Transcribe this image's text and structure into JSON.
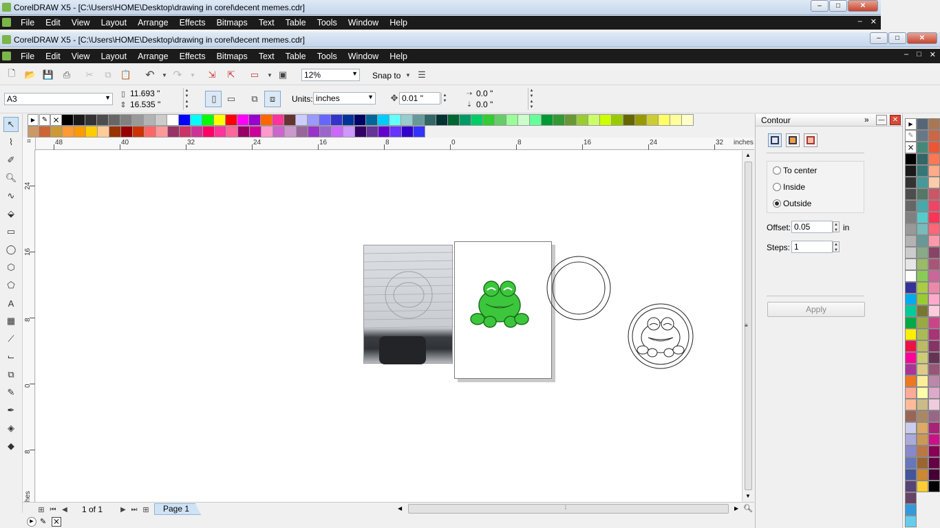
{
  "window_outer": {
    "title": "CorelDRAW X5 - [C:\\Users\\HOME\\Desktop\\drawing in corel\\decent memes.cdr]"
  },
  "window_inner": {
    "title": "CorelDRAW X5 - [C:\\Users\\HOME\\Desktop\\drawing in corel\\decent memes.cdr]"
  },
  "menu": {
    "items": [
      "File",
      "Edit",
      "View",
      "Layout",
      "Arrange",
      "Effects",
      "Bitmaps",
      "Text",
      "Table",
      "Tools",
      "Window",
      "Help"
    ]
  },
  "window_buttons": {
    "minimize": "–",
    "maximize": "□",
    "close": "✕"
  },
  "standard_toolbar": {
    "zoom_value": "12%",
    "snap_to_label": "Snap to"
  },
  "property_bar": {
    "page_size": "A3",
    "width": "11.693 \"",
    "height": "16.535 \"",
    "units_label": "Units:",
    "units_value": "inches",
    "nudge": "0.01 \"",
    "dup_x": "0.0 \"",
    "dup_y": "0.0 \""
  },
  "ruler": {
    "unit": "inches",
    "h_ticks": [
      "48",
      "40",
      "32",
      "24",
      "16",
      "8",
      "0",
      "8",
      "16",
      "24",
      "32"
    ],
    "v_ticks": [
      "24",
      "16",
      "8",
      "0",
      "8"
    ],
    "v_unit": "inches"
  },
  "status": {
    "page_count": "1 of 1",
    "page_tab": "Page 1"
  },
  "docker": {
    "title": "Contour",
    "options": [
      "To center",
      "Inside",
      "Outside"
    ],
    "selected_option": "Outside",
    "offset_label": "Offset:",
    "offset_value": "0.05",
    "offset_unit": "in",
    "steps_label": "Steps:",
    "steps_value": "1",
    "apply_label": "Apply"
  },
  "colors": {
    "menubar_bg": "#1b1b1b",
    "frog_green": "#3cc63c",
    "page_tab_bg": "#cfe3f5"
  },
  "palette_row1": [
    "#000000",
    "#1a1a1a",
    "#333333",
    "#4d4d4d",
    "#666666",
    "#808080",
    "#999999",
    "#b3b3b3",
    "#cccccc",
    "#ffffff",
    "#0000ff",
    "#00ffff",
    "#00ff00",
    "#ffff00",
    "#ff0000",
    "#ff00ff",
    "#9900cc",
    "#ff6600",
    "#ff3399",
    "#663333",
    "#ccccff",
    "#9999ff",
    "#6666ff",
    "#3333cc",
    "#003399",
    "#000066",
    "#006699",
    "#00ccff",
    "#66ffff",
    "#99cccc",
    "#669999",
    "#336666",
    "#003333",
    "#006633",
    "#009966",
    "#00cc66",
    "#33cc33",
    "#66cc66",
    "#99ff99",
    "#ccffcc",
    "#66ff99",
    "#009933",
    "#339933",
    "#669933",
    "#99cc33",
    "#ccff66",
    "#ccff00",
    "#99cc00",
    "#666600",
    "#999900",
    "#cccc33",
    "#ffff66",
    "#ffff99",
    "#ffffcc"
  ],
  "palette_row2": [
    "#cc9966",
    "#cc6633",
    "#cc9933",
    "#ff9933",
    "#ff9900",
    "#ffcc00",
    "#ffcc99",
    "#993300",
    "#990000",
    "#cc3300",
    "#ff6666",
    "#ff9999",
    "#993366",
    "#cc3366",
    "#cc3399",
    "#ff0066",
    "#ff3399",
    "#ff6699",
    "#990066",
    "#cc0099",
    "#ff99cc",
    "#cc66cc",
    "#cc99cc",
    "#996699",
    "#9933cc",
    "#9966cc",
    "#cc66ff",
    "#cc99ff",
    "#330066",
    "#663399",
    "#6600cc",
    "#6633ff",
    "#3300cc",
    "#3333ff"
  ],
  "right_palette_col1": [
    "#000000",
    "#1a1a1a",
    "#333333",
    "#4d4d4d",
    "#666666",
    "#808080",
    "#999999",
    "#b3b3b3",
    "#cccccc",
    "#e6e6e6",
    "#ffffff",
    "#333399",
    "#00aaee",
    "#00cc99",
    "#00aa44",
    "#ffee00",
    "#ee1144",
    "#ff0099",
    "#aa3399",
    "#ee7722",
    "#ffaa99",
    "#ffbb99",
    "#996655",
    "#ccccee",
    "#aaaadd",
    "#8888cc",
    "#6677bb",
    "#445599",
    "#554477",
    "#664466",
    "#3399dd",
    "#66ccee"
  ],
  "right_palette_col2": [
    "#556677",
    "#667788",
    "#448877",
    "#336666",
    "#337777",
    "#449999",
    "#557766",
    "#44aaaa",
    "#55cccc",
    "#77bbbb",
    "#669999",
    "#88aa88",
    "#99bb66",
    "#88cc55",
    "#aacc44",
    "#99cc33",
    "#777733",
    "#99aa44",
    "#aabb55",
    "#bbbb66",
    "#cccc77",
    "#ddcc88",
    "#ffee99",
    "#ffffaa",
    "#ccbb88",
    "#aa8866",
    "#ddaa66",
    "#cc9955",
    "#bb7744",
    "#996633",
    "#cc8833",
    "#ffcc33"
  ],
  "right_palette_col3": [
    "#aa7755",
    "#cc6644",
    "#ee5533",
    "#ff7755",
    "#ffaa88",
    "#ffccaa",
    "#cc5566",
    "#ee4466",
    "#ff3355",
    "#ff6677",
    "#ff99aa",
    "#884466",
    "#aa5577",
    "#cc6699",
    "#ee88aa",
    "#ffaacc",
    "#ffccdd",
    "#cc4488",
    "#aa3377",
    "#883366",
    "#663355",
    "#995577",
    "#bb88aa",
    "#ddaacc",
    "#eeccdd",
    "#996688",
    "#aa2277",
    "#cc1188",
    "#880055",
    "#660044",
    "#440033",
    "#000000"
  ]
}
